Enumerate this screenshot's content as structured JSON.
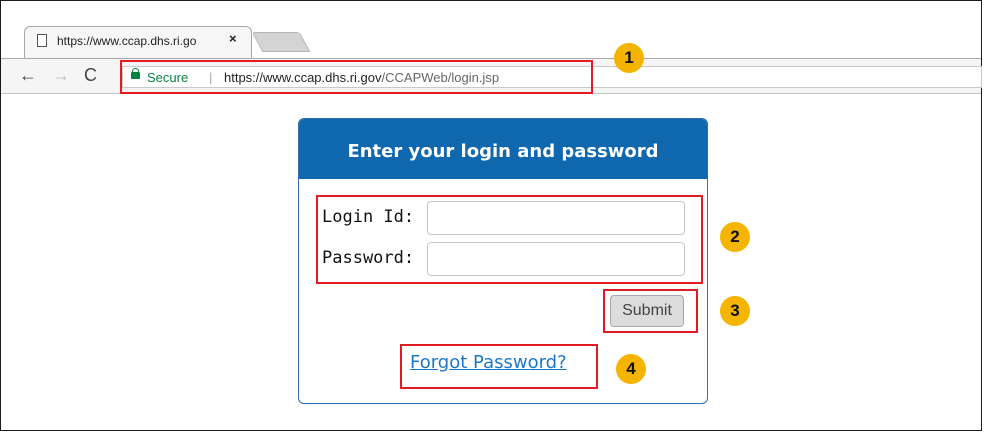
{
  "browser": {
    "tab_title": "https://www.ccap.dhs.ri.go",
    "tab_close": "×",
    "nav": {
      "back": "←",
      "forward": "→",
      "reload": "C"
    },
    "security_label": "Secure",
    "separator": "|",
    "url_host": "https://www.ccap.dhs.ri.gov",
    "url_path": "/CCAPWeb/login.jsp"
  },
  "login": {
    "title": "Enter your login and password",
    "login_id_label": "Login Id:",
    "login_id_value": "",
    "password_label": "Password:",
    "password_value": "",
    "submit_label": "Submit",
    "forgot_label": "Forgot Password?"
  },
  "annotations": {
    "badge1": "1",
    "badge2": "2",
    "badge3": "3",
    "badge4": "4",
    "highlight_color": "#e31b23",
    "badge_color": "#f4b400"
  },
  "colors": {
    "panel_header": "#0f68ad",
    "secure_green": "#0b8043",
    "link_blue": "#1b78c7"
  }
}
